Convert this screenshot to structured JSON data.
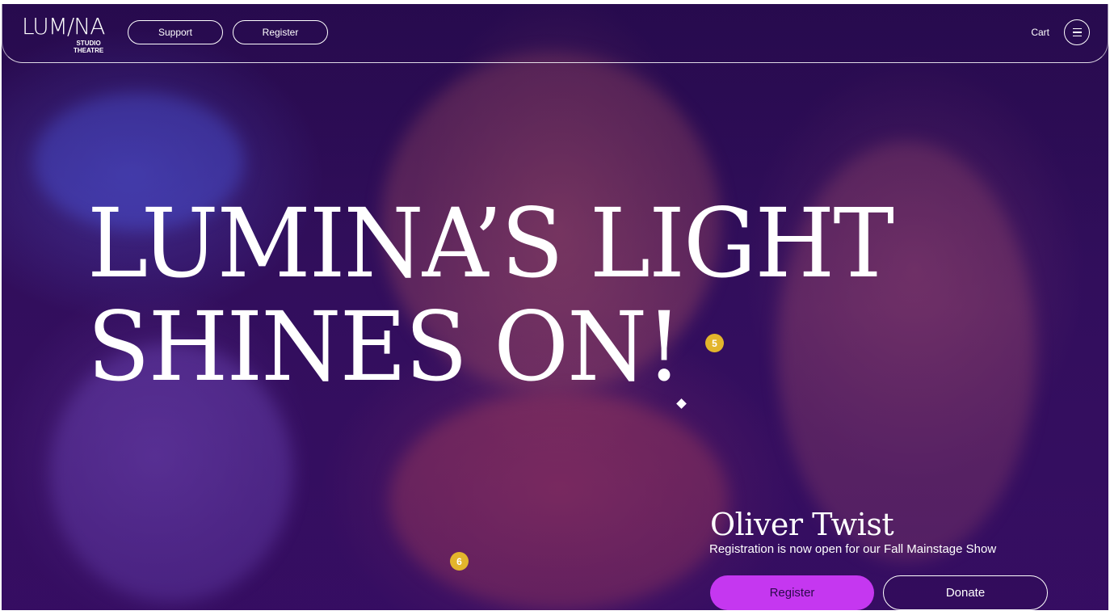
{
  "nav": {
    "logo_main": "LUM/NA",
    "logo_sub_1": "STUDIO",
    "logo_sub_2": "THEATRE",
    "support_label": "Support",
    "register_label": "Register",
    "cart_label": "Cart",
    "menu_icon": "hamburger-icon"
  },
  "hero": {
    "headline_line1": "LUMINA’S LIGHT",
    "headline_line2": "SHINES ON!",
    "show_title": "Oliver Twist",
    "show_subtitle": "Registration is now open for our Fall Mainstage Show",
    "register_button": "Register",
    "donate_button": "Donate"
  },
  "markers": [
    "5",
    "6"
  ],
  "colors": {
    "background": "#330f5e",
    "accent": "#c537f0",
    "marker": "#e3b52c",
    "text": "#ffffff"
  }
}
